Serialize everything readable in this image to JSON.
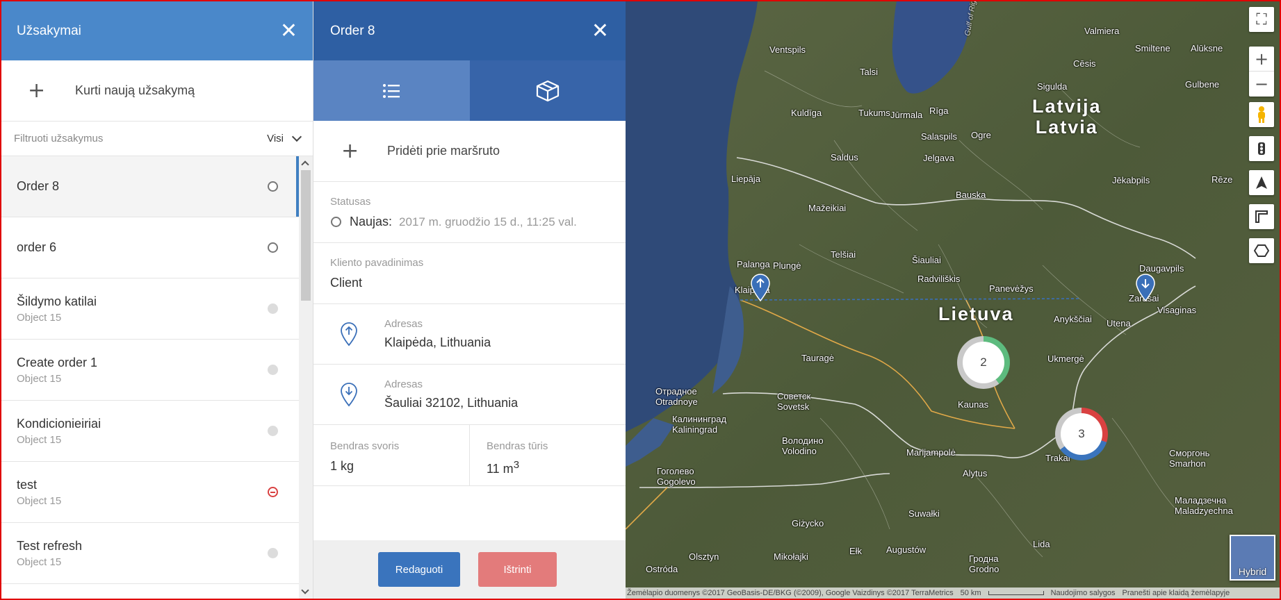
{
  "left_panel": {
    "title": "Užsakymai",
    "create_label": "Kurti naują užsakymą",
    "filter_label": "Filtruoti užsakymus",
    "filter_value": "Visi",
    "orders": [
      {
        "name": "Order 8",
        "sub": "",
        "status": "new"
      },
      {
        "name": "order 6",
        "sub": "",
        "status": "new"
      },
      {
        "name": "Šildymo katilai",
        "sub": "Object 15",
        "status": "grey"
      },
      {
        "name": "Create order 1",
        "sub": "Object 15",
        "status": "grey"
      },
      {
        "name": "Kondicionieiriai",
        "sub": "Object 15",
        "status": "grey"
      },
      {
        "name": "test",
        "sub": "Object 15",
        "status": "cancelled"
      },
      {
        "name": "Test refresh",
        "sub": "Object 15",
        "status": "grey"
      }
    ]
  },
  "detail_panel": {
    "title": "Order 8",
    "tabs": [
      {
        "icon": "list-icon"
      },
      {
        "icon": "package-icon"
      }
    ],
    "add_route_label": "Pridėti prie maršruto",
    "status_label": "Statusas",
    "status_value": "Naujas:",
    "status_date": "2017 m. gruodžio 15 d., 11:25 val.",
    "client_label": "Kliento pavadinimas",
    "client_value": "Client",
    "pickup_label": "Adresas",
    "pickup_value": "Klaipėda, Lithuania",
    "delivery_label": "Adresas",
    "delivery_value": "Šauliai 32102, Lithuania",
    "weight_label": "Bendras svoris",
    "weight_value": "1 kg",
    "volume_label": "Bendras tūris",
    "volume_value": "11 m",
    "volume_unit_sup": "3",
    "edit_button": "Redaguoti",
    "delete_button": "Ištrinti"
  },
  "map": {
    "country_labels": [
      {
        "text": "Latvija\nLatvia"
      },
      {
        "text": "Lietuva"
      }
    ],
    "cities": [
      "Ventspils",
      "Talsi",
      "Kuldīga",
      "Tukums",
      "Jūrmala",
      "Rīga",
      "Salaspils",
      "Ogre",
      "Sigulda",
      "Cēsis",
      "Valmiera",
      "Smiltene",
      "Alūksne",
      "Gulbene",
      "Saldus",
      "Jelgava",
      "Bauska",
      "Liepāja",
      "Jēkabpils",
      "Rēze",
      "Mažeikiai",
      "Telšiai",
      "Šiauliai",
      "Radviliškis",
      "Plungė",
      "Palanga",
      "Klaipėda",
      "Panevėžys",
      "Daugavpils",
      "Zarasai",
      "Visaginas",
      "Anykščiai",
      "Utena",
      "Tauragė",
      "Ukmergė",
      "Kaunas",
      "Советск Sovetsk",
      "Отрадное Otradnoye",
      "Калининград Kaliningrad",
      "Володино Volodino",
      "Marijampolė",
      "Trakai",
      "Гоголево Gogolevo",
      "Alytus",
      "Сморгонь Smarhon",
      "Маладзечна Maladzyechna",
      "Suwałki",
      "Giżycko",
      "Ełk",
      "Augustów",
      "Гродна Grodno",
      "Lida",
      "Olsztyn",
      "Mikołajki",
      "Ostróda",
      "Gulf of Riga"
    ],
    "clusters": [
      {
        "count": "2",
        "color": "#5dbb7e"
      },
      {
        "count": "3",
        "color": "#d94141"
      }
    ],
    "hybrid_label": "Hybrid",
    "attribution": "Žemėlapio duomenys ©2017 GeoBasis-DE/BKG (©2009), Google Vaizdinys ©2017 TerraMetrics",
    "scale": "50 km",
    "terms": "Naudojimo salygos",
    "report": "Pranešti apie klaidą žemėlapyje"
  },
  "colors": {
    "left_header": "#4a88ca",
    "detail_header": "#2e5fa3",
    "edit": "#3a74bd",
    "delete": "#e37b7b"
  }
}
